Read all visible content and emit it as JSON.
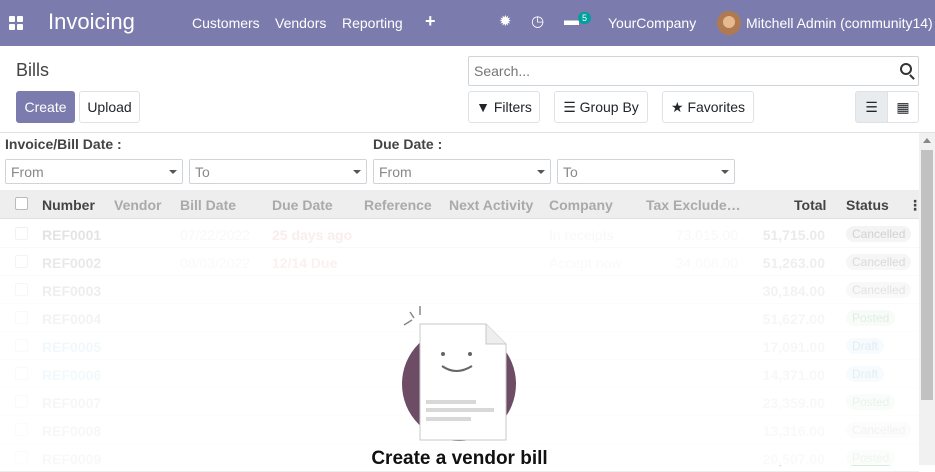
{
  "navbar": {
    "brand": "Invoicing",
    "menus": [
      "Customers",
      "Vendors",
      "Reporting"
    ],
    "messages_badge": "5",
    "company": "YourCompany",
    "user": "Mitchell Admin (community14)"
  },
  "page": {
    "title": "Bills",
    "create": "Create",
    "upload": "Upload"
  },
  "search": {
    "placeholder": "Search...",
    "filters": "Filters",
    "group_by": "Group By",
    "favorites": "Favorites"
  },
  "filters": {
    "invoice_date_label": "Invoice/Bill Date :",
    "due_date_label": "Due Date :",
    "from": "From",
    "to": "To"
  },
  "table": {
    "columns": [
      "Number",
      "Vendor",
      "Bill Date",
      "Due Date",
      "Reference",
      "Next Activity",
      "Company",
      "Tax Exclude…",
      "Total",
      "Status"
    ],
    "rows": [
      {
        "number": "REF0001",
        "bill_date": "07/22/2022",
        "due_date": "25 days ago",
        "company": "In receipts",
        "untaxed": "73,015.00",
        "total": "51,715.00",
        "status": "Cancelled"
      },
      {
        "number": "REF0002",
        "bill_date": "08/03/2022",
        "due_date": "12/14 Due",
        "company": "Accept now",
        "untaxed": "34,008.00",
        "total": "51,263.00",
        "status": "Cancelled"
      },
      {
        "number": "REF0003",
        "bill_date": "",
        "due_date": "",
        "company": "",
        "untaxed": "",
        "total": "30,184.00",
        "status": "Cancelled"
      },
      {
        "number": "REF0004",
        "bill_date": "",
        "due_date": "",
        "company": "",
        "untaxed": "",
        "total": "51,627.00",
        "status": "Posted"
      },
      {
        "number": "REF0005",
        "bill_date": "",
        "due_date": "",
        "company": "",
        "untaxed": "",
        "total": "17,091.00",
        "status": "Draft"
      },
      {
        "number": "REF0006",
        "bill_date": "",
        "due_date": "",
        "company": "",
        "untaxed": "",
        "total": "14,371.00",
        "status": "Draft"
      },
      {
        "number": "REF0007",
        "bill_date": "",
        "due_date": "",
        "company": "",
        "untaxed": "",
        "total": "23,359.00",
        "status": "Posted"
      },
      {
        "number": "REF0008",
        "bill_date": "",
        "due_date": "",
        "company": "",
        "untaxed": "",
        "total": "13,316.00",
        "status": "Cancelled"
      },
      {
        "number": "REF0009",
        "bill_date": "",
        "due_date": "",
        "company": "",
        "untaxed": "",
        "total": "20,507.00",
        "status": "Posted"
      }
    ]
  },
  "help": {
    "title": "Create a vendor bill"
  },
  "colors": {
    "brand": "#7c7bad",
    "badge": "#00a09d",
    "illustration": "#6d4c65"
  }
}
